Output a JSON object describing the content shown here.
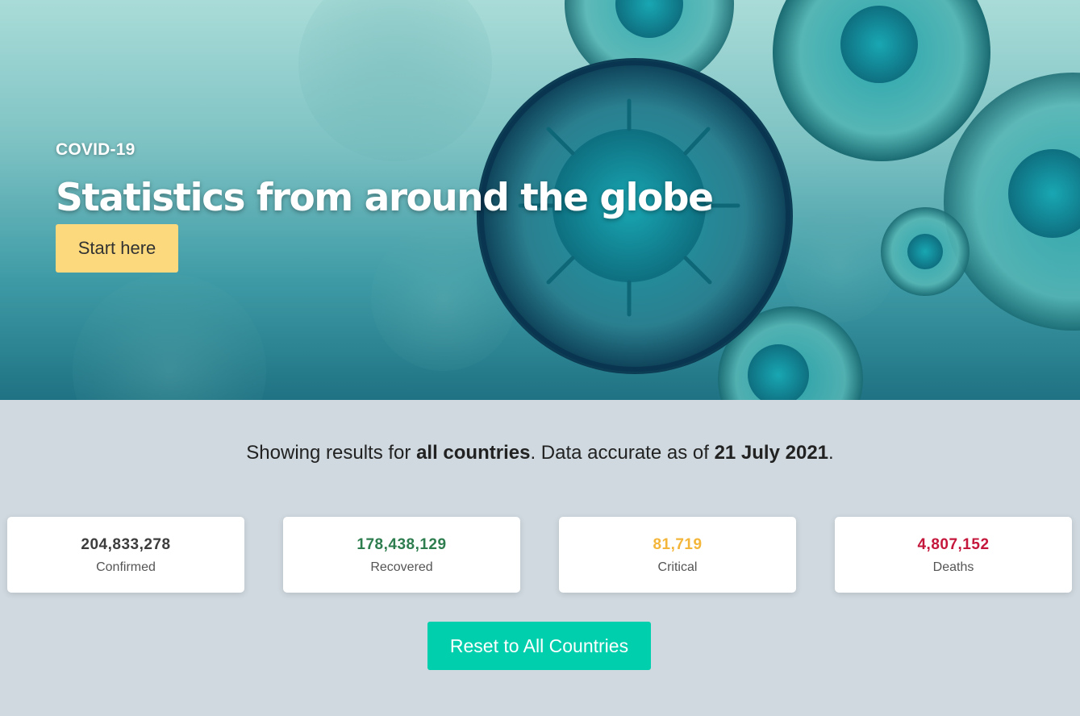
{
  "hero": {
    "eyebrow": "COVID-19",
    "headline": "Statistics from around the globe",
    "start_label": "Start here"
  },
  "summary": {
    "prefix": "Showing results for ",
    "scope": "all countries",
    "middle": ". Data accurate as of ",
    "date": "21 July 2021",
    "suffix": "."
  },
  "stats": [
    {
      "value": "204,833,278",
      "label": "Confirmed",
      "color": "#3d3d3d"
    },
    {
      "value": "178,438,129",
      "label": "Recovered",
      "color": "#2e7d4f"
    },
    {
      "value": "81,719",
      "label": "Critical",
      "color": "#f3b63a"
    },
    {
      "value": "4,807,152",
      "label": "Deaths",
      "color": "#c4173b"
    }
  ],
  "reset_label": "Reset to All Countries",
  "colors": {
    "start_button": "#fcd97c",
    "reset_button": "#00cfad",
    "page_bg": "#cfd9df"
  },
  "hero_image": "virus-cells-illustration"
}
